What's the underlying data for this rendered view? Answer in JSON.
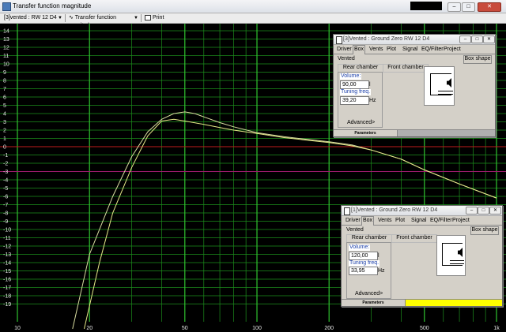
{
  "window": {
    "title": "Transfer function magnitude",
    "buttons": {
      "minimize": "–",
      "maximize": "□",
      "close": "✕"
    }
  },
  "toolbar": {
    "driver_select": "[3]vented : RW 12 D4",
    "view_select": "Transfer function magnitude",
    "print_label": "Print"
  },
  "colors": {
    "plot_bg": "#000000",
    "grid": "#1c8f1c",
    "grid_bright": "#2fc22f",
    "curve_1": "#d8dca0",
    "curve_3": "#e6e888",
    "ref_line": "#c01c1c",
    "ref_line_2": "#9c1c6c",
    "status_yellow": "#ffff00"
  },
  "chart_data": {
    "type": "line",
    "title": "",
    "xlabel": "",
    "ylabel": "",
    "x_scale": "log",
    "xlim": [
      10,
      1000
    ],
    "ylim": [
      -20,
      15
    ],
    "grid": true,
    "x_tick_labels": [
      {
        "x": 10,
        "label": "10"
      },
      {
        "x": 20,
        "label": "20"
      },
      {
        "x": 50,
        "label": "50"
      },
      {
        "x": 100,
        "label": "100"
      },
      {
        "x": 200,
        "label": "200"
      },
      {
        "x": 500,
        "label": "500"
      },
      {
        "x": 1000,
        "label": "1k"
      }
    ],
    "x_minor": [
      30,
      40,
      60,
      70,
      80,
      90,
      300,
      400,
      600,
      700,
      800,
      900
    ],
    "y_ticks": [
      14,
      13,
      12,
      11,
      10,
      9,
      8,
      7,
      6,
      5,
      4,
      3,
      2,
      1,
      0,
      -1,
      -2,
      -3,
      -4,
      -5,
      -6,
      -7,
      -8,
      -9,
      -10,
      -11,
      -12,
      -13,
      -14,
      -15,
      -16,
      -17,
      -18,
      -19
    ],
    "reference_lines": [
      {
        "y": 0
      },
      {
        "y": -3
      }
    ],
    "series": [
      {
        "key": "vented1",
        "x": [
          17,
          20,
          25,
          30,
          35,
          40,
          45,
          50,
          55,
          60,
          70,
          80,
          100,
          130,
          160,
          200,
          250,
          300,
          400,
          500,
          700,
          1000
        ],
        "values": [
          -22,
          -13,
          -6,
          -1.2,
          1.8,
          3.3,
          4.0,
          4.2,
          4.0,
          3.6,
          2.9,
          2.4,
          1.7,
          1.2,
          0.9,
          0.6,
          0.2,
          -0.4,
          -1.5,
          -2.8,
          -4.5,
          -6.2
        ]
      },
      {
        "key": "vented3",
        "x": [
          19,
          22,
          25,
          30,
          35,
          40,
          45,
          50,
          60,
          70,
          80,
          100,
          130,
          160,
          200,
          250,
          300,
          400,
          500,
          700,
          1000
        ],
        "values": [
          -22,
          -14,
          -8,
          -2.5,
          1.3,
          3.1,
          3.3,
          3.1,
          2.7,
          2.3,
          2.0,
          1.6,
          1.1,
          0.8,
          0.5,
          0.1,
          -0.4,
          -1.5,
          -2.8,
          -4.5,
          -6.2
        ]
      }
    ]
  },
  "dialog3": {
    "title": "[3]Vented : Ground Zero RW 12 D4",
    "tabs": [
      "Driver",
      "Box",
      "Vents",
      "Plot",
      "Signal",
      "EQ/Filter",
      "Project"
    ],
    "active_tab": "Box",
    "box_type": "Vented",
    "box_shape_button": "Box shape",
    "rear_chamber": "Rear chamber",
    "front_chamber": "Front chamber",
    "volume_label": "Volume:",
    "volume_value": "90,00",
    "volume_unit": "l",
    "tuning_label": "Tuning freq.",
    "tuning_value": "39,20",
    "tuning_unit": "Hz",
    "advanced": "Advanced>",
    "status_label": "Parameters"
  },
  "dialog1": {
    "title": "[1]Vented : Ground Zero RW 12 D4",
    "tabs": [
      "Driver",
      "Box",
      "Vents",
      "Plot",
      "Signal",
      "EQ/Filter",
      "Project"
    ],
    "active_tab": "Box",
    "box_type": "Vented",
    "box_shape_button": "Box shape",
    "rear_chamber": "Rear chamber",
    "front_chamber": "Front chamber",
    "volume_label": "Volume:",
    "volume_value": "120,00",
    "volume_unit": "l",
    "tuning_label": "Tuning freq.",
    "tuning_value": "33,95",
    "tuning_unit": "Hz",
    "advanced": "Advanced>",
    "status_label": "Parameters"
  }
}
